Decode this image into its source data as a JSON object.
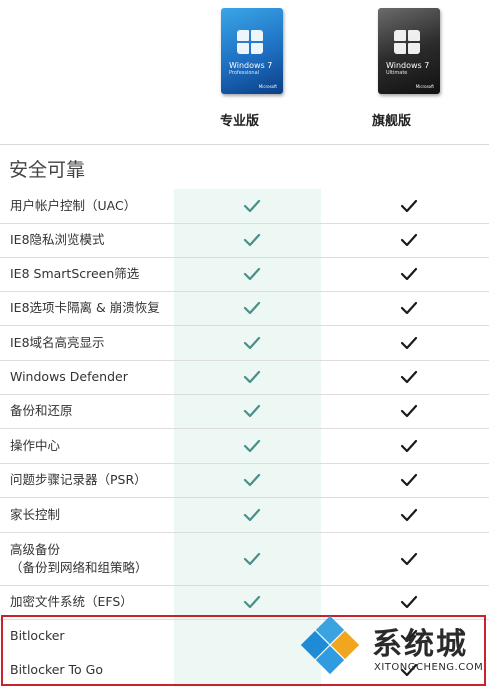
{
  "products": [
    {
      "box_name": "Windows 7",
      "box_edition": "Professional",
      "box_logo": "Microsoft",
      "edition_label": "专业版"
    },
    {
      "box_name": "Windows 7",
      "box_edition": "Ultimate",
      "box_logo": "Microsoft",
      "edition_label": "旗舰版"
    }
  ],
  "section_title": "安全可靠",
  "features": [
    {
      "label": "用户帐户控制（UAC）",
      "professional": true,
      "ultimate": true
    },
    {
      "label": "IE8隐私浏览模式",
      "professional": true,
      "ultimate": true
    },
    {
      "label": "IE8 SmartScreen筛选",
      "professional": true,
      "ultimate": true
    },
    {
      "label": "IE8选项卡隔离 & 崩溃恢复",
      "professional": true,
      "ultimate": true
    },
    {
      "label": "IE8域名高亮显示",
      "professional": true,
      "ultimate": true
    },
    {
      "label": "Windows Defender",
      "professional": true,
      "ultimate": true
    },
    {
      "label": "备份和还原",
      "professional": true,
      "ultimate": true
    },
    {
      "label": "操作中心",
      "professional": true,
      "ultimate": true
    },
    {
      "label": "问题步骤记录器（PSR）",
      "professional": true,
      "ultimate": true
    },
    {
      "label": "家长控制",
      "professional": true,
      "ultimate": true
    },
    {
      "label": "高级备份\n（备份到网络和组策略）",
      "professional": true,
      "ultimate": true
    },
    {
      "label": "加密文件系统（EFS）",
      "professional": true,
      "ultimate": true
    },
    {
      "label": "Bitlocker",
      "professional": false,
      "ultimate": true
    },
    {
      "label": "Bitlocker To Go",
      "professional": false,
      "ultimate": true
    }
  ],
  "colors": {
    "pro_check": "#4a8f8a",
    "ult_check": "#1a1a1a",
    "highlight_column": "#edf8f5",
    "red_frame": "#c8232c"
  },
  "watermark": {
    "title": "系统城",
    "subtitle": "XITONGCHENG.COM"
  }
}
